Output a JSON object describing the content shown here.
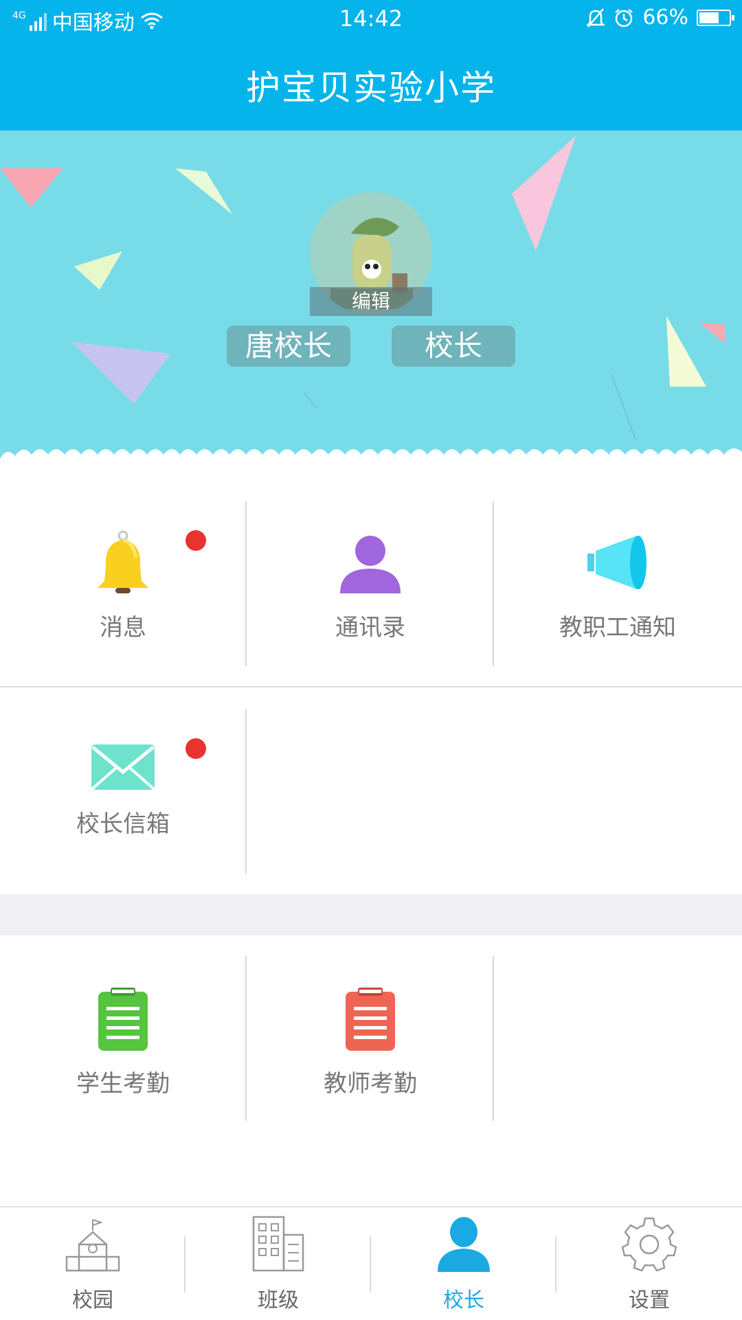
{
  "status_bar": {
    "network": "4G",
    "carrier": "中国移动",
    "time": "14:42",
    "battery": "66%",
    "battery_level": 0.66
  },
  "header": {
    "title": "护宝贝实验小学"
  },
  "profile": {
    "edit_label": "编辑",
    "name": "唐校长",
    "role": "校长"
  },
  "menu_row1": [
    {
      "label": "消息",
      "icon": "bell-icon",
      "badge": true
    },
    {
      "label": "通讯录",
      "icon": "contacts-person-icon",
      "badge": false
    },
    {
      "label": "教职工通知",
      "icon": "megaphone-icon",
      "badge": false
    }
  ],
  "menu_row2": [
    {
      "label": "校长信箱",
      "icon": "envelope-icon",
      "badge": true
    }
  ],
  "menu_row3": [
    {
      "label": "学生考勤",
      "icon": "clipboard-green-icon"
    },
    {
      "label": "教师考勤",
      "icon": "clipboard-red-icon"
    }
  ],
  "tabs": [
    {
      "label": "校园",
      "icon": "school-building-icon"
    },
    {
      "label": "班级",
      "icon": "office-building-icon"
    },
    {
      "label": "校长",
      "icon": "user-icon",
      "active": true
    },
    {
      "label": "设置",
      "icon": "gear-icon"
    }
  ],
  "colors": {
    "primary": "#04b4ea",
    "hero_bg": "#78dce8",
    "badge": "#e8332e",
    "active_tab": "#1aa9e2"
  }
}
